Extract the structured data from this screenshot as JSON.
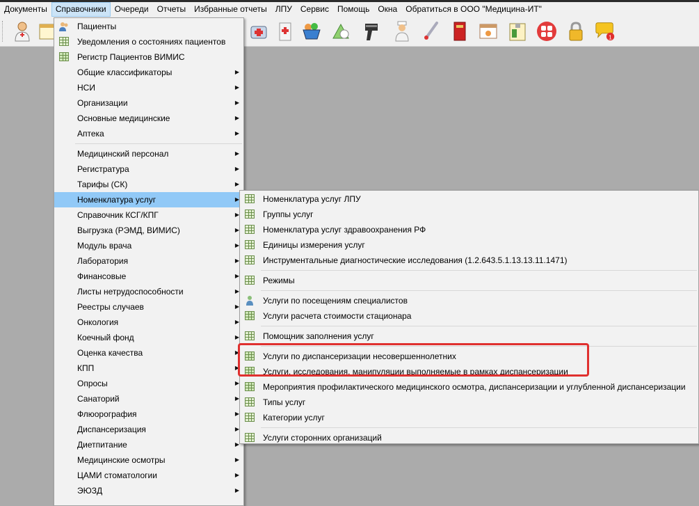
{
  "menubar": {
    "items": [
      {
        "label": "Документы"
      },
      {
        "label": "Справочники"
      },
      {
        "label": "Очереди"
      },
      {
        "label": "Отчеты"
      },
      {
        "label": "Избранные отчеты"
      },
      {
        "label": "ЛПУ"
      },
      {
        "label": "Сервис"
      },
      {
        "label": "Помощь"
      },
      {
        "label": "Окна"
      },
      {
        "label": "Обратиться в ООО \"Медицина-ИТ\""
      }
    ]
  },
  "toolbar": {
    "icons": [
      "doctor-icon",
      "calendar-icon",
      "medical-kit-icon",
      "medical-cabinet-icon",
      "basket-icon",
      "pills-icon",
      "barcode-scanner-icon",
      "nurse-icon",
      "thermometer-icon",
      "book-icon",
      "window-icon",
      "schedule-icon",
      "apps-icon",
      "lock-icon",
      "chat-notification-icon"
    ],
    "badge_count": "1"
  },
  "main_menu": {
    "items": [
      {
        "label": "Пациенты",
        "icon": "patients-icon",
        "submenu": false
      },
      {
        "label": "Уведомления о состояниях пациентов",
        "icon": "table-icon",
        "submenu": false
      },
      {
        "label": "Регистр Пациентов ВИМИС",
        "icon": "table-icon",
        "submenu": false
      },
      {
        "label": "Общие классификаторы",
        "submenu": true
      },
      {
        "label": "НСИ",
        "submenu": true
      },
      {
        "label": "Организации",
        "submenu": true
      },
      {
        "label": "Основные медицинские",
        "submenu": true
      },
      {
        "label": "Аптека",
        "submenu": true
      },
      {
        "label": "Медицинский персонал",
        "submenu": true
      },
      {
        "label": "Регистратура",
        "submenu": true
      },
      {
        "label": "Тарифы (СК)",
        "submenu": true
      },
      {
        "label": "Номенклатура услуг",
        "submenu": true,
        "highlighted": true
      },
      {
        "label": "Справочник КСГ/КПГ",
        "submenu": true
      },
      {
        "label": "Выгрузка (РЭМД, ВИМИС)",
        "submenu": true
      },
      {
        "label": "Модуль врача",
        "submenu": true
      },
      {
        "label": "Лаборатория",
        "submenu": true
      },
      {
        "label": "Финансовые",
        "submenu": true
      },
      {
        "label": "Листы нетрудоспособности",
        "submenu": true
      },
      {
        "label": "Реестры случаев",
        "submenu": true
      },
      {
        "label": "Онкология",
        "submenu": true
      },
      {
        "label": "Коечный фонд",
        "submenu": true
      },
      {
        "label": "Оценка качества",
        "submenu": true
      },
      {
        "label": "КПП",
        "submenu": true
      },
      {
        "label": "Опросы",
        "submenu": true
      },
      {
        "label": "Санаторий",
        "submenu": true
      },
      {
        "label": "Флюорография",
        "submenu": true
      },
      {
        "label": "Диспансеризация",
        "submenu": true
      },
      {
        "label": "Диетпитание",
        "submenu": true
      },
      {
        "label": "Медицинские осмотры",
        "submenu": true
      },
      {
        "label": "ЦАМИ стоматологии",
        "submenu": true
      },
      {
        "label": "ЭЮЗД",
        "submenu": true
      }
    ]
  },
  "submenu": {
    "items": [
      {
        "label": "Номенклатура услуг ЛПУ",
        "icon": "table-icon"
      },
      {
        "label": "Группы услуг",
        "icon": "table-icon"
      },
      {
        "label": "Номенклатура услуг здравоохранения РФ",
        "icon": "table-icon"
      },
      {
        "label": "Единицы измерения услуг",
        "icon": "table-icon"
      },
      {
        "label": "Инструментальные диагностические исследования (1.2.643.5.1.13.13.11.1471)",
        "icon": "table-icon"
      },
      {
        "label": "Режимы",
        "icon": "table-icon"
      },
      {
        "label": "Услуги по посещениям специалистов",
        "icon": "specialist-icon"
      },
      {
        "label": "Услуги расчета стоимости стационара",
        "icon": "table-icon"
      },
      {
        "label": "Помощник заполнения услуг",
        "icon": "table-icon"
      },
      {
        "label": "Услуги по диспансеризации несовершеннолетних",
        "icon": "table-icon"
      },
      {
        "label": "Услуги, исследования, манипуляции выполняемые в рамках диспансеризации",
        "icon": "table-icon"
      },
      {
        "label": "Мероприятия профилактического медицинского осмотра, диспансеризации и углубленной диспансеризации",
        "icon": "table-icon"
      },
      {
        "label": "Типы услуг",
        "icon": "table-icon"
      },
      {
        "label": "Категории услуг",
        "icon": "table-icon"
      },
      {
        "label": "Услуги сторонних организаций",
        "icon": "table-icon"
      }
    ]
  },
  "colors": {
    "menu_highlight": "#91c9f7",
    "annotation_box": "#e0302f"
  }
}
